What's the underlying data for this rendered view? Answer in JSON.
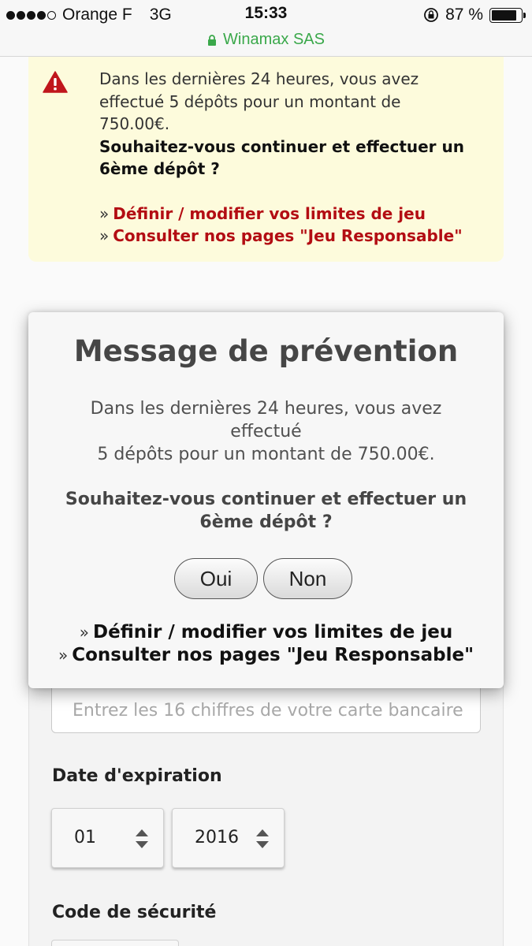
{
  "status_bar": {
    "carrier": "Orange F",
    "network": "3G",
    "time": "15:33",
    "battery_percent": "87 %",
    "battery_level": 0.87,
    "url": "Winamax SAS"
  },
  "warning": {
    "line1": "Dans les dernières 24 heures, vous avez",
    "line2": "effectué 5 dépôts pour un montant de",
    "line3": "750.00€.",
    "question_line1": "Souhaitez-vous continuer et effectuer un",
    "question_line2": "6ème dépôt ?",
    "chevron": "»",
    "link_limits": "Définir / modifier vos limites de jeu",
    "link_responsible": "Consulter nos pages \"Jeu Responsable\""
  },
  "modal": {
    "title": "Message de prévention",
    "message_line1": "Dans les dernières 24 heures, vous avez",
    "message_line2": "effectué",
    "message_line3": "5 dépôts pour un montant de 750.00€.",
    "question_line1": "Souhaitez-vous continuer et effectuer un",
    "question_line2": "6ème dépôt ?",
    "yes_label": "Oui",
    "no_label": "Non",
    "chevron": "»",
    "link_limits": "Définir / modifier vos limites de jeu",
    "link_responsible": "Consulter nos pages \"Jeu Responsable\""
  },
  "form": {
    "card_number_placeholder": "Entrez les 16 chiffres de votre carte bancaire",
    "expiration_label": "Date d'expiration",
    "expiration_month": "01",
    "expiration_year": "2016",
    "security_code_label": "Code de sécurité"
  },
  "colors": {
    "link_red": "#b30d13",
    "secure_green": "#3aa84a",
    "warning_bg": "#fdfbdc",
    "alert_red": "#c0161c"
  },
  "icons": {
    "warning": "warning-triangle-icon",
    "lock": "lock-icon",
    "orientation_lock": "orientation-lock-icon",
    "select_arrows": "up-down-arrows-icon"
  }
}
